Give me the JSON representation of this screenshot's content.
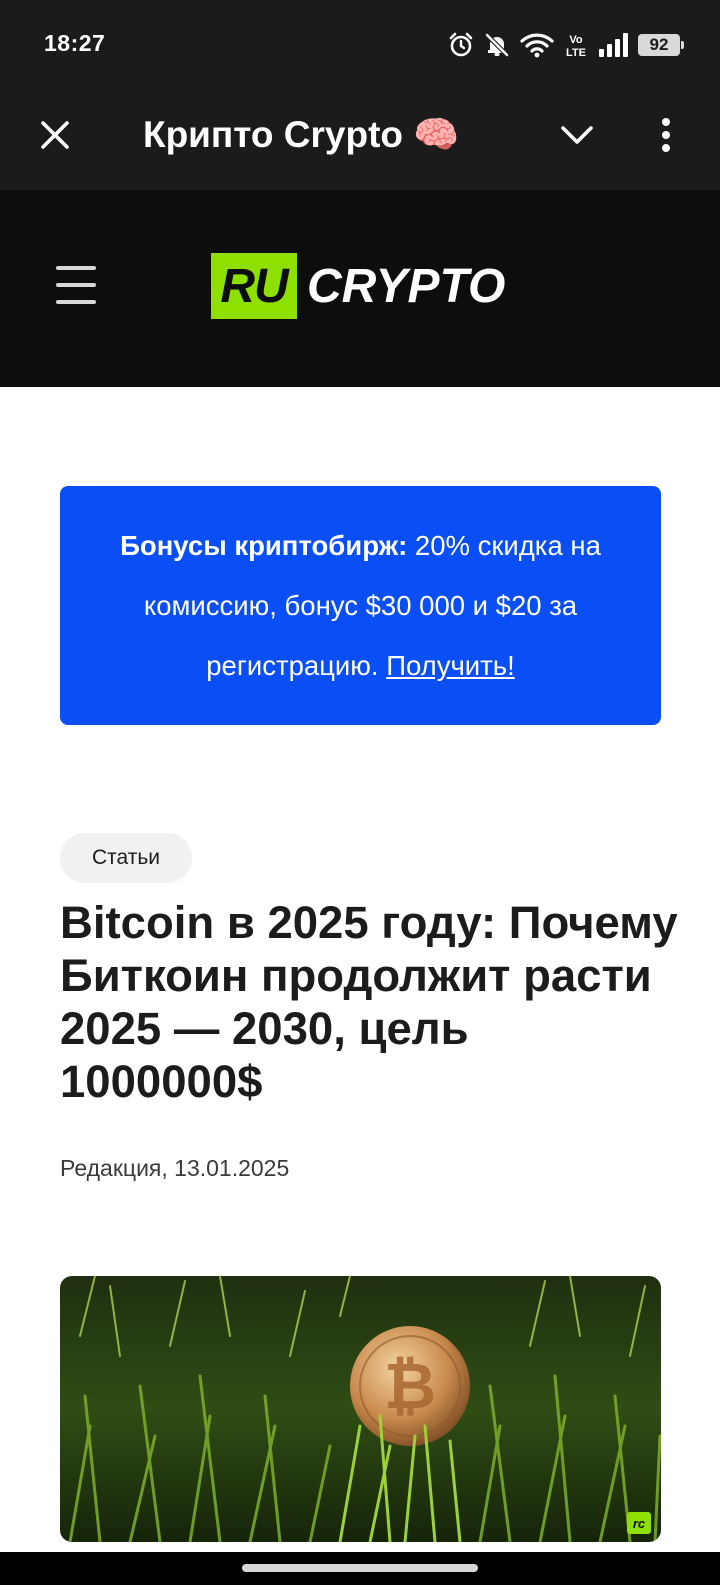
{
  "status_bar": {
    "time": "18:27",
    "network_label": "Vo LTE",
    "battery_level": "92",
    "icons": [
      "alarm-icon",
      "notifications-off-icon",
      "wifi-icon",
      "volte-icon",
      "signal-icon",
      "battery-icon"
    ]
  },
  "tab": {
    "title": "Крипто Crypto 🧠",
    "close_icon": "close-icon",
    "collapse_icon": "chevron-down-icon",
    "more_icon": "more-vertical-icon"
  },
  "site": {
    "logo_ru": "RU",
    "logo_crypto": "CRYPTO",
    "logo_color": "#8ee000",
    "menu_icon": "hamburger-icon"
  },
  "promo": {
    "bold_text": "Бонусы криптобирж:",
    "text": " 20% скидка на комиссию, бонус $30 000 и $20 за регистрацию. ",
    "link_text": "Получить!",
    "background": "#0a4ef5"
  },
  "article": {
    "category": "Статьи",
    "title": "Bitcoin в 2025 году: Почему Биткоин продолжит расти 2025 — 2030, цель 1000000$",
    "meta": "Редакция, 13.01.2025",
    "image_badge": "rc"
  }
}
